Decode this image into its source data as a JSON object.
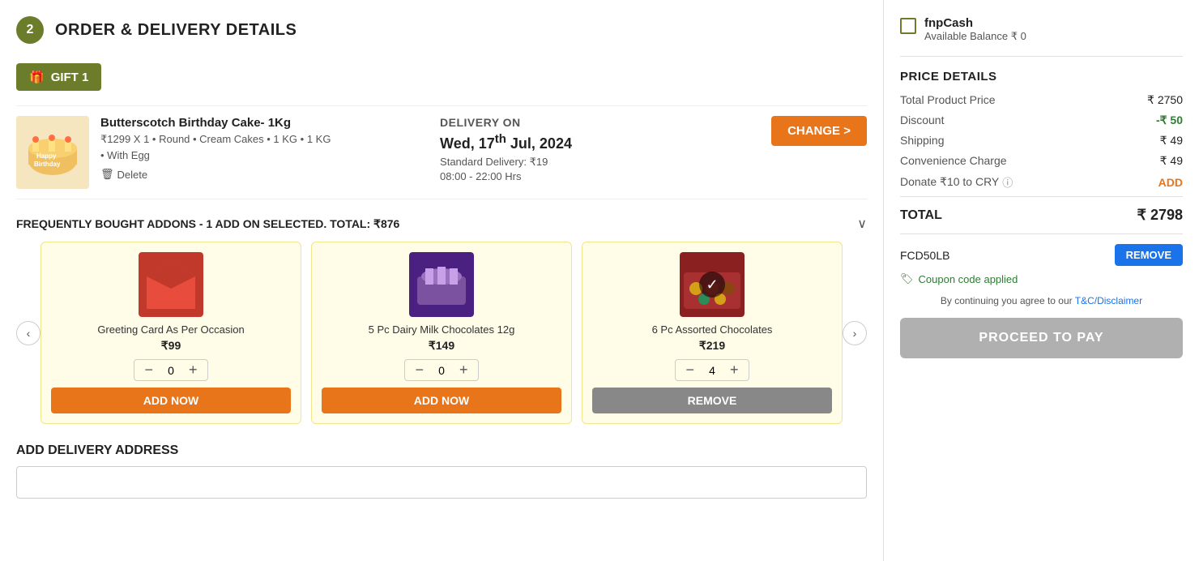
{
  "header": {
    "step": "2",
    "title": "ORDER & DELIVERY DETAILS"
  },
  "gift": {
    "label": "GIFT 1"
  },
  "product": {
    "name": "Butterscotch Birthday Cake- 1Kg",
    "price_detail": "₹1299 X 1 • Round • Cream Cakes • 1 KG • 1 KG",
    "egg_option": "With Egg",
    "delete_label": "Delete",
    "delivery_label": "DELIVERY ON",
    "delivery_date_part1": "Wed, 17",
    "delivery_date_sup": "th",
    "delivery_date_part2": " Jul, 2024",
    "delivery_type": "Standard Delivery: ₹19",
    "delivery_hours": "08:00 - 22:00 Hrs",
    "change_btn": "CHANGE >"
  },
  "addons": {
    "title": "FREQUENTLY BOUGHT ADDONS",
    "subtitle": " - 1 ADD ON SELECTED. TOTAL: ₹876",
    "chevron": "∨",
    "items": [
      {
        "name": "Greeting Card As Per Occasion",
        "price": "₹99",
        "qty": 0,
        "selected": false,
        "add_btn": "ADD NOW",
        "img_color": "#e8c0c0"
      },
      {
        "name": "5 Pc Dairy Milk Chocolates 12g",
        "price": "₹149",
        "qty": 0,
        "selected": false,
        "add_btn": "ADD NOW",
        "img_color": "#7b52a0"
      },
      {
        "name": "6 Pc Assorted Chocolates",
        "price": "₹219",
        "qty": 4,
        "selected": true,
        "remove_btn": "REMOVE",
        "img_color": "#c0392b"
      }
    ]
  },
  "address_section": {
    "title": "ADD DELIVERY ADDRESS"
  },
  "sidebar": {
    "fnpcash_title": "fnpCash",
    "fnpcash_balance": "Available Balance ₹ 0",
    "price_details_title": "PRICE DETAILS",
    "total_product_price_label": "Total Product Price",
    "total_product_price_value": "₹ 2750",
    "discount_label": "Discount",
    "discount_value": "-₹ 50",
    "shipping_label": "Shipping",
    "shipping_value": "₹ 49",
    "convenience_label": "Convenience Charge",
    "convenience_value": "₹ 49",
    "donate_label": "Donate ₹10 to CRY",
    "add_donate_link": "ADD",
    "total_label": "TOTAL",
    "total_value": "₹ 2798",
    "coupon_code": "FCD50LB",
    "remove_coupon_btn": "REMOVE",
    "coupon_applied_text": "Coupon code applied",
    "tc_text": "By continuing you agree to our ",
    "tc_link": "T&C/Disclaimer",
    "proceed_btn": "PROCEED TO PAY"
  }
}
